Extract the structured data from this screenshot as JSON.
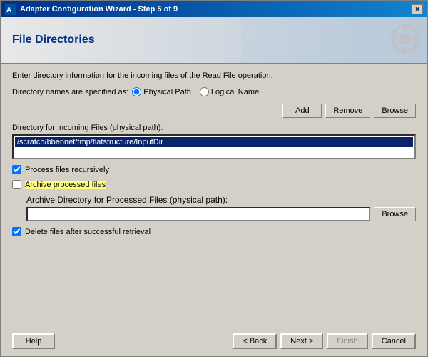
{
  "window": {
    "title": "Adapter Configuration Wizard - Step 5 of 9",
    "close_label": "×"
  },
  "header": {
    "title": "File Directories"
  },
  "content": {
    "info_text": "Enter directory information for the incoming files of the Read File operation.",
    "directory_label_prefix": "Directory names are specified as:",
    "radio_physical": "Physical Path",
    "radio_logical": "Logical Name",
    "add_button": "Add",
    "remove_button": "Remove",
    "browse_button": "Browse",
    "dir_section_label": "Directory for Incoming Files (physical path):",
    "dir_value": "/scratch/bbennet/tmp/flatstructure/InputDir",
    "process_recursive_label": "Process files recursively",
    "archive_label": "Archive processed files",
    "archive_dir_label": "Archive Directory for Processed Files (physical path):",
    "archive_browse_button": "Browse",
    "delete_files_label": "Delete files after successful retrieval"
  },
  "footer": {
    "help_label": "Help",
    "back_label": "< Back",
    "next_label": "Next >",
    "finish_label": "Finish",
    "cancel_label": "Cancel"
  },
  "state": {
    "radio_selected": "physical",
    "process_recursive_checked": true,
    "archive_checked": false,
    "delete_files_checked": true
  }
}
